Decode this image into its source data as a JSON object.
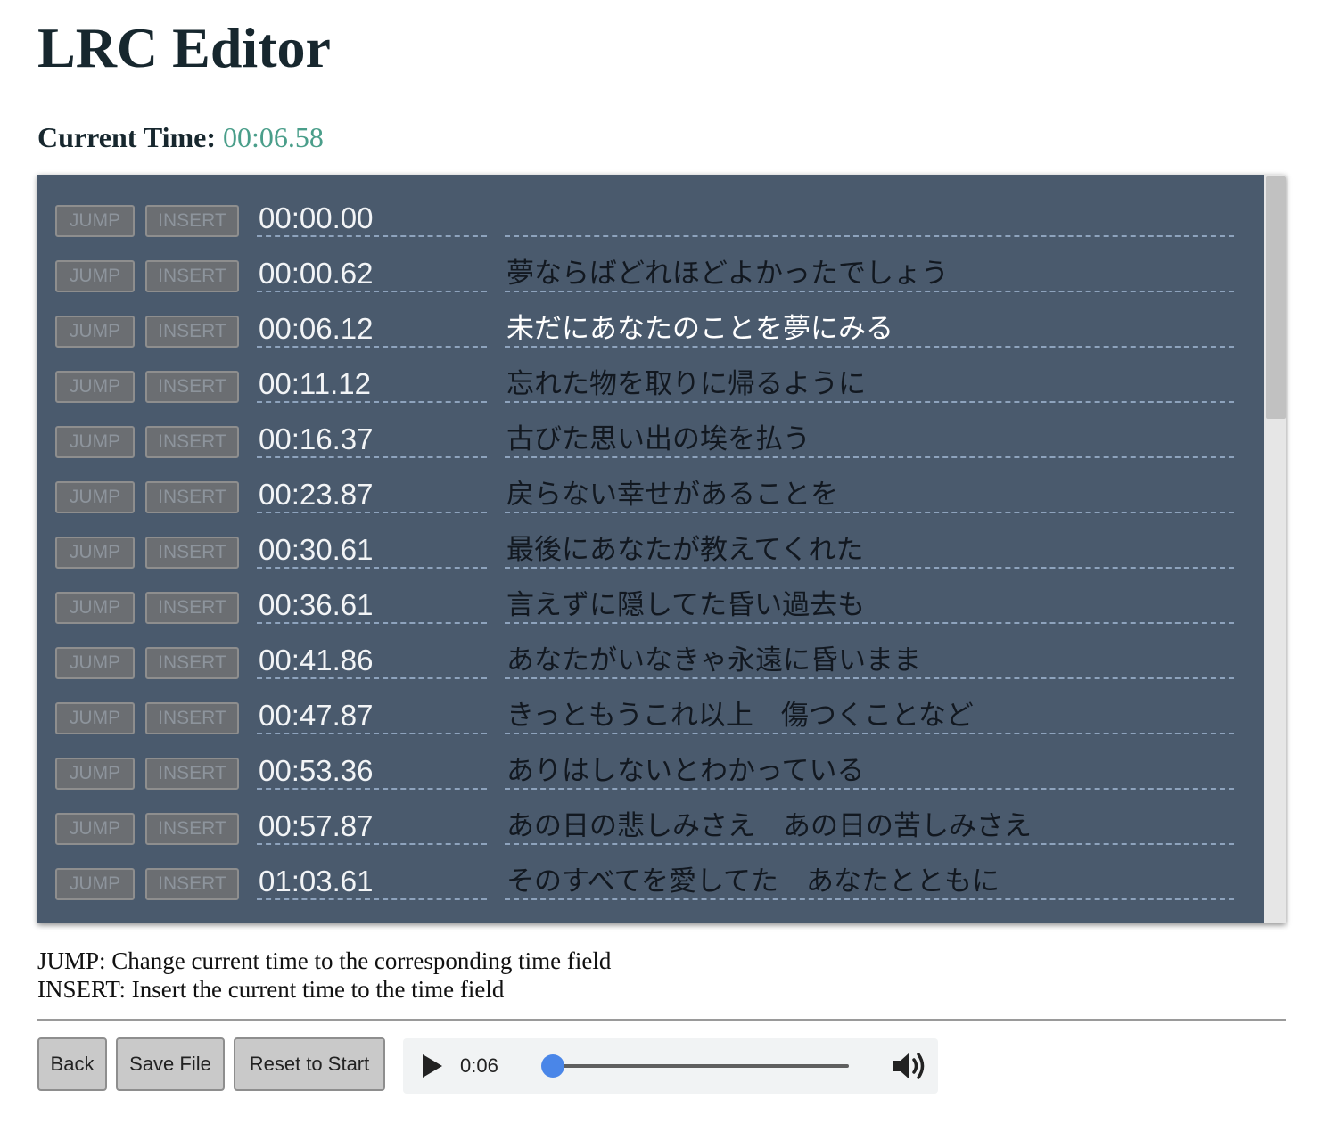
{
  "app": {
    "title": "LRC Editor"
  },
  "current_time": {
    "label": "Current Time:",
    "value": "00:06.58"
  },
  "editor": {
    "jump_label": "JUMP",
    "insert_label": "INSERT",
    "active_index": 2,
    "rows": [
      {
        "time": "00:00.00",
        "lyric": ""
      },
      {
        "time": "00:00.62",
        "lyric": "夢ならばどれほどよかったでしょう"
      },
      {
        "time": "00:06.12",
        "lyric": "未だにあなたのことを夢にみる"
      },
      {
        "time": "00:11.12",
        "lyric": "忘れた物を取りに帰るように"
      },
      {
        "time": "00:16.37",
        "lyric": "古びた思い出の埃を払う"
      },
      {
        "time": "00:23.87",
        "lyric": "戻らない幸せがあることを"
      },
      {
        "time": "00:30.61",
        "lyric": "最後にあなたが教えてくれた"
      },
      {
        "time": "00:36.61",
        "lyric": "言えずに隠してた昏い過去も"
      },
      {
        "time": "00:41.86",
        "lyric": "あなたがいなきゃ永遠に昏いまま"
      },
      {
        "time": "00:47.87",
        "lyric": "きっともうこれ以上　傷つくことなど"
      },
      {
        "time": "00:53.36",
        "lyric": "ありはしないとわかっている"
      },
      {
        "time": "00:57.87",
        "lyric": "あの日の悲しみさえ　あの日の苦しみさえ"
      },
      {
        "time": "01:03.61",
        "lyric": "そのすべてを愛してた　あなたとともに"
      }
    ]
  },
  "help": {
    "jump": "JUMP: Change current time to the corresponding time field",
    "insert": "INSERT: Insert the current time to the time field"
  },
  "buttons": {
    "back": "Back",
    "save": "Save File",
    "reset": "Reset to Start"
  },
  "player": {
    "time": "0:06",
    "progress": 0.035,
    "play_icon": "play-icon",
    "volume_icon": "volume-icon"
  }
}
